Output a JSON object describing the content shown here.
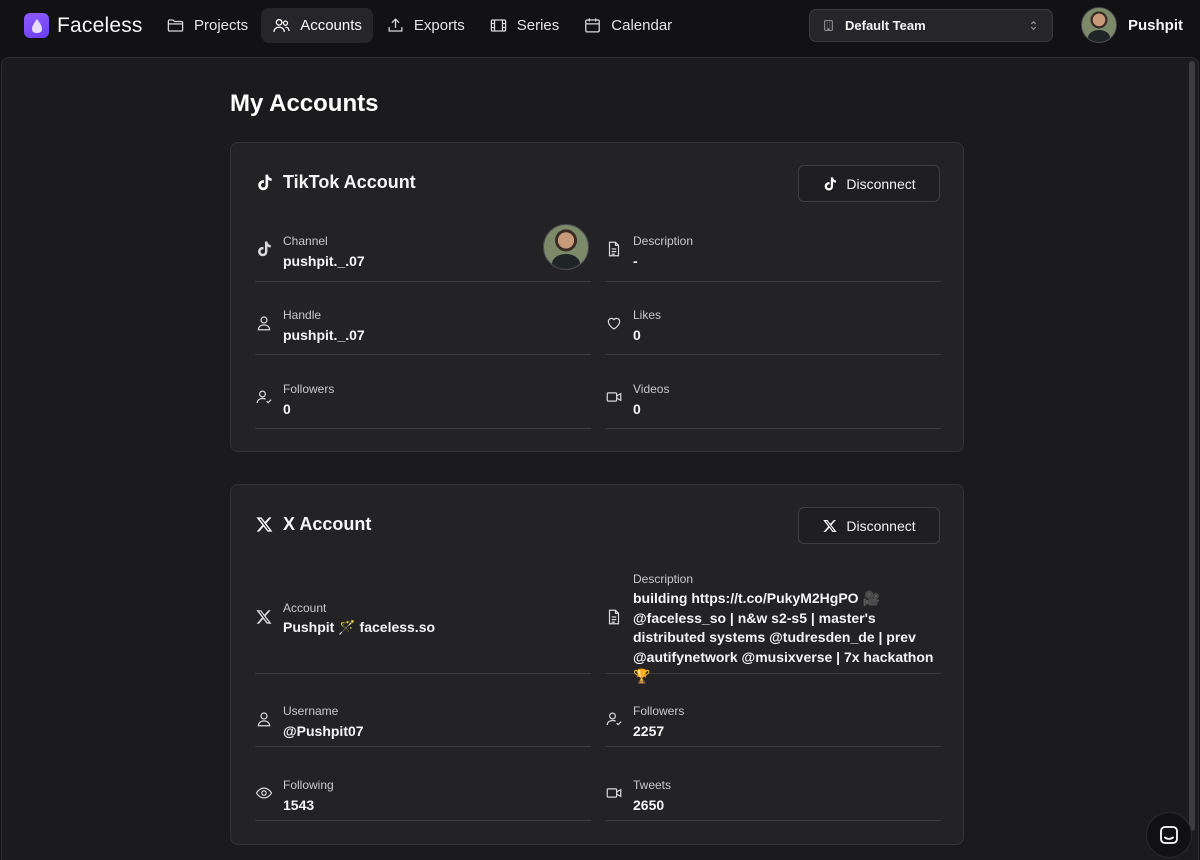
{
  "brand": {
    "name": "Faceless",
    "logo_icon": "faceless-logo-icon",
    "accent": "#7c4dff"
  },
  "nav": {
    "items": [
      {
        "label": "Projects",
        "icon": "folder-icon"
      },
      {
        "label": "Accounts",
        "icon": "users-icon",
        "active": true
      },
      {
        "label": "Exports",
        "icon": "upload-icon"
      },
      {
        "label": "Series",
        "icon": "film-icon"
      },
      {
        "label": "Calendar",
        "icon": "calendar-icon"
      }
    ]
  },
  "team_select": {
    "value": "Default Team",
    "icon": "building-icon"
  },
  "user": {
    "name": "Pushpit"
  },
  "page": {
    "title": "My Accounts"
  },
  "tiktok": {
    "title": "TikTok Account",
    "disconnect_label": "Disconnect",
    "fields": {
      "channel": {
        "label": "Channel",
        "value": "pushpit._.07"
      },
      "description": {
        "label": "Description",
        "value": "-"
      },
      "handle": {
        "label": "Handle",
        "value": "pushpit._.07"
      },
      "likes": {
        "label": "Likes",
        "value": "0"
      },
      "followers": {
        "label": "Followers",
        "value": "0"
      },
      "videos": {
        "label": "Videos",
        "value": "0"
      }
    }
  },
  "x": {
    "title": "X Account",
    "disconnect_label": "Disconnect",
    "fields": {
      "account": {
        "label": "Account",
        "value": "Pushpit 🪄 faceless.so"
      },
      "description": {
        "label": "Description",
        "value": "building https://t.co/PukyM2HgPO 🎥 @faceless_so | n&w s2-s5 | master's distributed systems @tudresden_de | prev @autifynetwork @musixverse | 7x hackathon🏆"
      },
      "username": {
        "label": "Username",
        "value": "@Pushpit07"
      },
      "followers": {
        "label": "Followers",
        "value": "2257"
      },
      "following": {
        "label": "Following",
        "value": "1543"
      },
      "tweets": {
        "label": "Tweets",
        "value": "2650"
      }
    }
  },
  "chat_widget": {
    "icon": "chat-icon"
  }
}
